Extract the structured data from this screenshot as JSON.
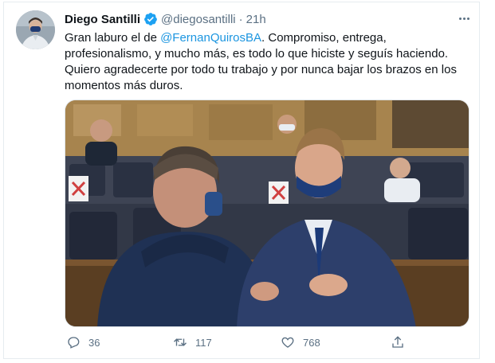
{
  "tweet": {
    "author_name": "Diego Santilli",
    "verified_badge": "verified-icon",
    "handle": "@diegosantilli",
    "separator": "·",
    "time": "21h",
    "text_before": "Gran laburo el de ",
    "mention": "@FernanQuirosBA",
    "text_after": ". Compromiso, entrega, profesionalismo, y mucho más, es todo lo que hiciste y seguís haciendo. Quiero agradecerte por todo tu trabajo y por nunca bajar los brazos en los momentos más duros."
  },
  "actions": {
    "reply_count": "36",
    "retweet_count": "117",
    "like_count": "768"
  },
  "colors": {
    "link": "#1b95e0",
    "verified": "#1da1f2",
    "muted": "#5b7083"
  },
  "icons": [
    "more-icon",
    "reply-icon",
    "retweet-icon",
    "like-icon",
    "share-icon"
  ]
}
